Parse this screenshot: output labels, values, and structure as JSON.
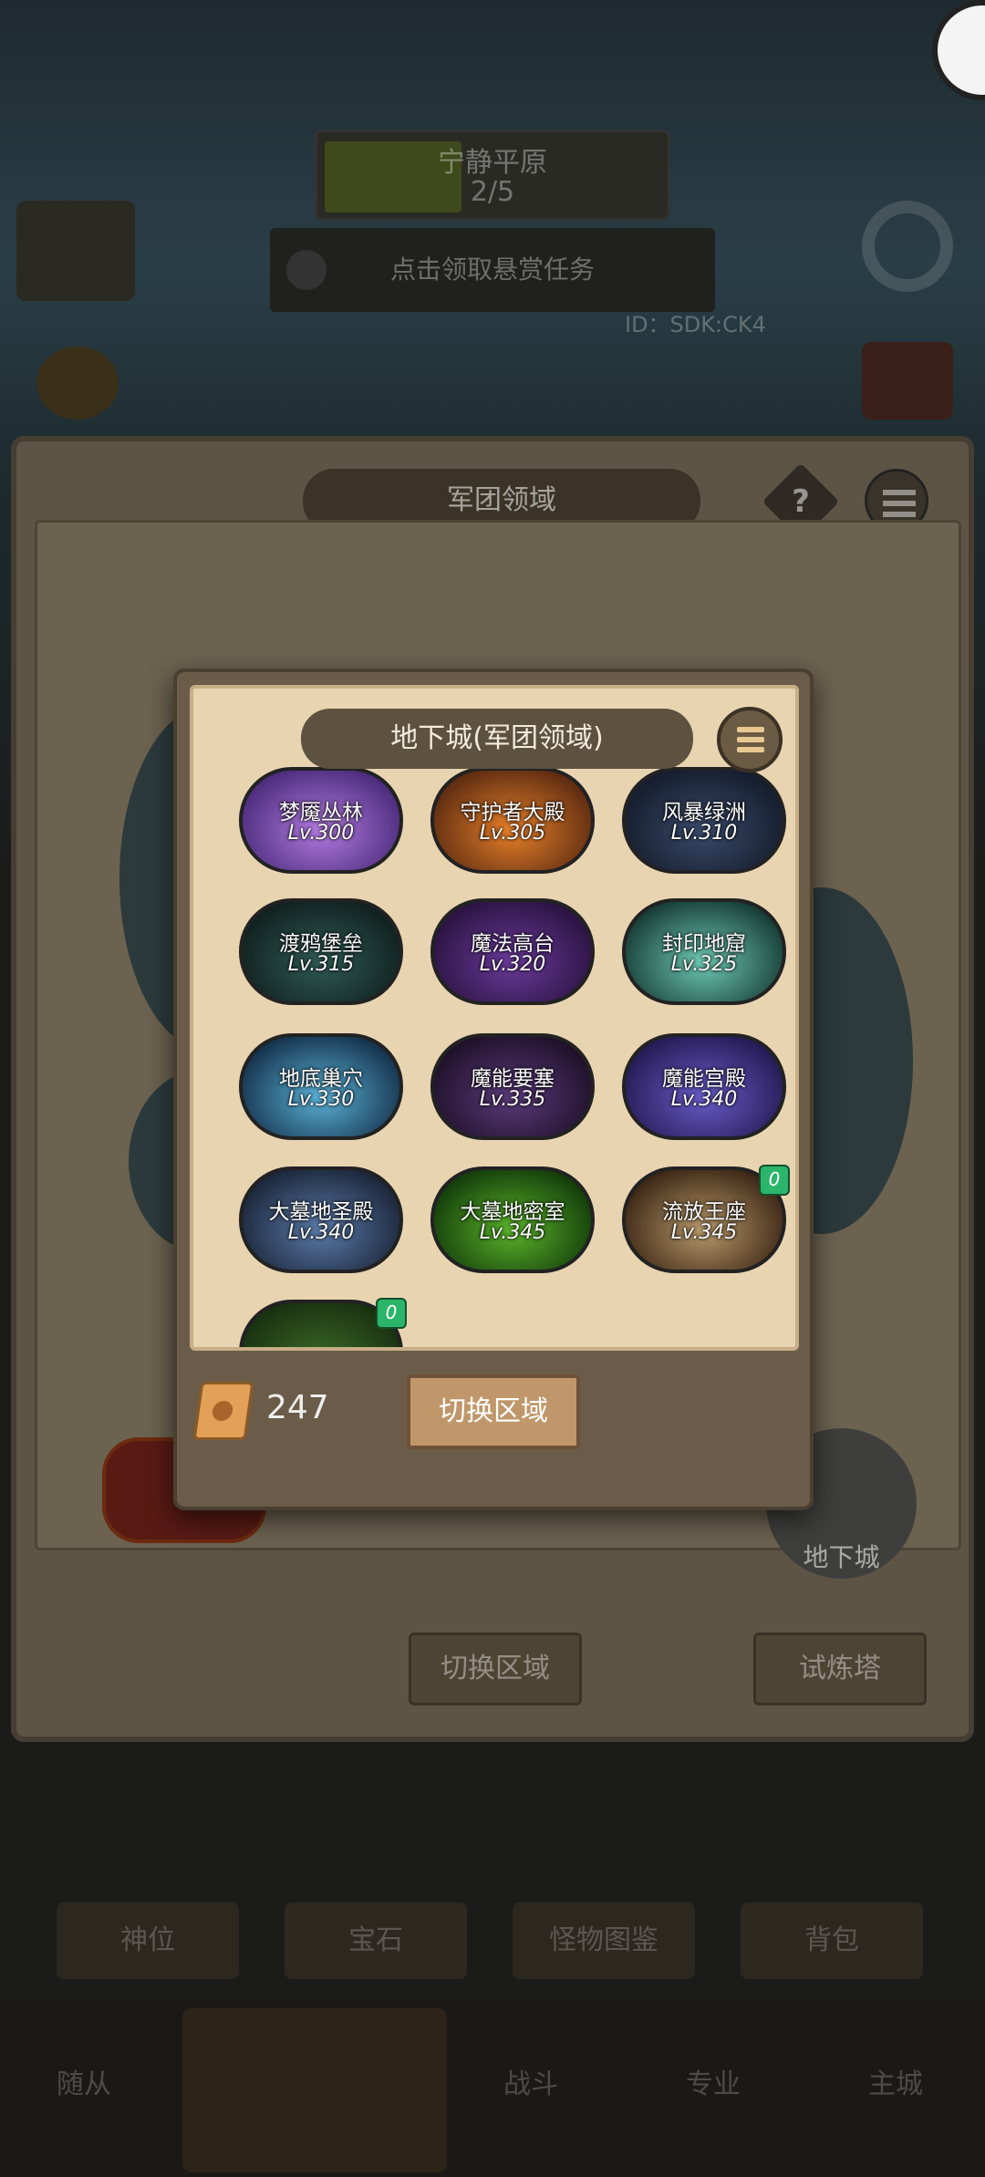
{
  "background": {
    "top_bar_line1": "宁静平原",
    "top_bar_line2": "2/5",
    "bounty_label": "点击领取悬赏任务",
    "player_id_text": "ID：SDK:CK4",
    "legion_title": "军团领域",
    "help_glyph": "?",
    "buttons": {
      "switch_area": "切换区域",
      "trial_tower": "试炼塔"
    },
    "dungeon_bubble_label": "地下城",
    "bottom_tabs": [
      "神位",
      "宝石",
      "怪物图鉴",
      "背包"
    ],
    "bottom_nav": [
      "随从",
      "战斗",
      "专业",
      "主城"
    ]
  },
  "modal": {
    "title": "地下城(军团领域)",
    "menu_icon": "hamburger-icon",
    "dungeons": [
      {
        "name": "梦魇丛林",
        "level": "Lv.300",
        "color1": "#b27be0",
        "color2": "#4a2a7a"
      },
      {
        "name": "守护者大殿",
        "level": "Lv.305",
        "color1": "#e8802a",
        "color2": "#5a2a10"
      },
      {
        "name": "风暴绿洲",
        "level": "Lv.310",
        "color1": "#3a4a6a",
        "color2": "#141c2c"
      },
      {
        "name": "渡鸦堡垒",
        "level": "Lv.315",
        "color1": "#2f5a55",
        "color2": "#10201e"
      },
      {
        "name": "魔法高台",
        "level": "Lv.320",
        "color1": "#6a3a9a",
        "color2": "#2a1240"
      },
      {
        "name": "封印地窟",
        "level": "Lv.325",
        "color1": "#6ecab5",
        "color2": "#163a34"
      },
      {
        "name": "地底巢穴",
        "level": "Lv.330",
        "color1": "#5ab2d8",
        "color2": "#14304a"
      },
      {
        "name": "魔能要塞",
        "level": "Lv.335",
        "color1": "#5a3a7a",
        "color2": "#1e1028"
      },
      {
        "name": "魔能宫殿",
        "level": "Lv.340",
        "color1": "#6a5ac8",
        "color2": "#241a52"
      },
      {
        "name": "大墓地圣殿",
        "level": "Lv.340",
        "color1": "#5a7aa8",
        "color2": "#1a2538"
      },
      {
        "name": "大墓地密室",
        "level": "Lv.345",
        "color1": "#5ab42a",
        "color2": "#123a0a"
      },
      {
        "name": "流放王座",
        "level": "Lv.345",
        "color1": "#b89a6a",
        "color2": "#3a2414",
        "badge": "0"
      }
    ],
    "partial_card": {
      "badge": "0",
      "color1": "#3a6a28",
      "color2": "#183010"
    },
    "scroll_icon": "scroll-icon",
    "scroll_count": "247",
    "switch_button": "切换区域"
  }
}
